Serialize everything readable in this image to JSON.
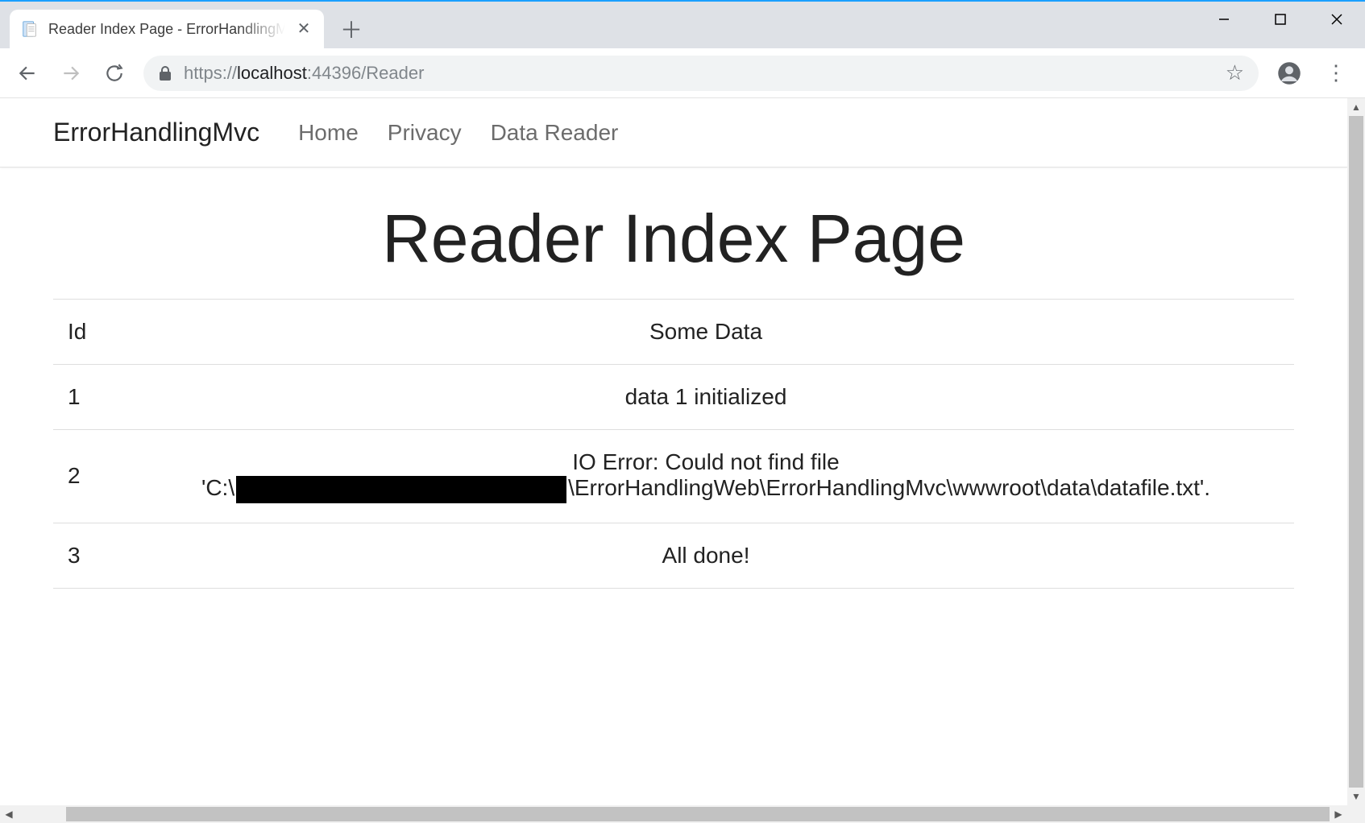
{
  "browser": {
    "tab_title": "Reader Index Page - ErrorHandlingMvc",
    "url_scheme": "https://",
    "url_host": "localhost",
    "url_port_path": ":44396/Reader"
  },
  "page": {
    "brand": "ErrorHandlingMvc",
    "nav": {
      "home": "Home",
      "privacy": "Privacy",
      "reader": "Data Reader"
    },
    "title": "Reader Index Page",
    "columns": {
      "id": "Id",
      "data": "Some Data"
    },
    "rows": {
      "r1": {
        "id": "1",
        "data": "data 1 initialized"
      },
      "r2": {
        "id": "2",
        "err_prefix": "IO Error: Could not find file",
        "path_before": "'C:\\",
        "path_after": "\\ErrorHandlingWeb\\ErrorHandlingMvc\\wwwroot\\data\\datafile.txt'."
      },
      "r3": {
        "id": "3",
        "data": "All done!"
      }
    }
  }
}
